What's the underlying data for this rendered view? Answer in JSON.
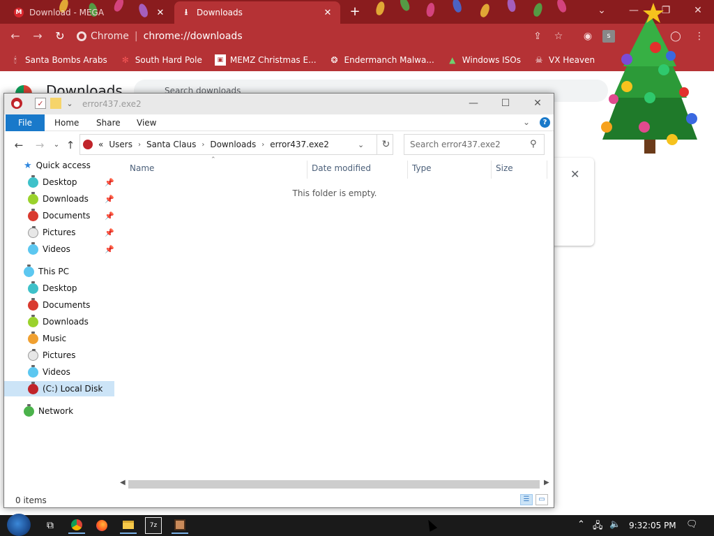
{
  "browser": {
    "tabs": [
      {
        "title": "Download - MEGA",
        "active": false
      },
      {
        "title": "Downloads",
        "active": true
      }
    ],
    "omnibox": {
      "chip": "Chrome",
      "url": "chrome://downloads"
    },
    "bookmarks": [
      {
        "label": "Santa Bombs Arabs",
        "icon": "candle-icon"
      },
      {
        "label": "South Hard Pole",
        "icon": "snowflake-icon"
      },
      {
        "label": "MEMZ Christmas E...",
        "icon": "page-icon"
      },
      {
        "label": "Endermanch Malwa...",
        "icon": "paw-icon"
      },
      {
        "label": "Windows ISOs",
        "icon": "tree-icon"
      },
      {
        "label": "VX Heaven",
        "icon": "skull-icon"
      }
    ],
    "page_title": "Downloads",
    "page_search_placeholder": "Search downloads"
  },
  "explorer": {
    "title": "error437.exe2",
    "ribbon_tabs": [
      "File",
      "Home",
      "Share",
      "View"
    ],
    "breadcrumb": [
      "Users",
      "Santa Claus",
      "Downloads",
      "error437.exe2"
    ],
    "breadcrumb_prefix": "«",
    "search_placeholder": "Search error437.exe2",
    "nav": {
      "quick_access": {
        "label": "Quick access",
        "items": [
          "Desktop",
          "Downloads",
          "Documents",
          "Pictures",
          "Videos"
        ]
      },
      "this_pc": {
        "label": "This PC",
        "items": [
          "Desktop",
          "Documents",
          "Downloads",
          "Music",
          "Pictures",
          "Videos",
          "(C:) Local Disk"
        ]
      },
      "network": {
        "label": "Network"
      }
    },
    "columns": [
      "Name",
      "Date modified",
      "Type",
      "Size"
    ],
    "empty_message": "This folder is empty.",
    "status": "0 items"
  },
  "taskbar": {
    "time": "9:32:05 PM"
  },
  "colors": {
    "chrome_frame": "#8a1c1e",
    "chrome_toolbar": "#b53235",
    "ribbon_file": "#1979ca",
    "taskbar": "#1a1a1a"
  }
}
